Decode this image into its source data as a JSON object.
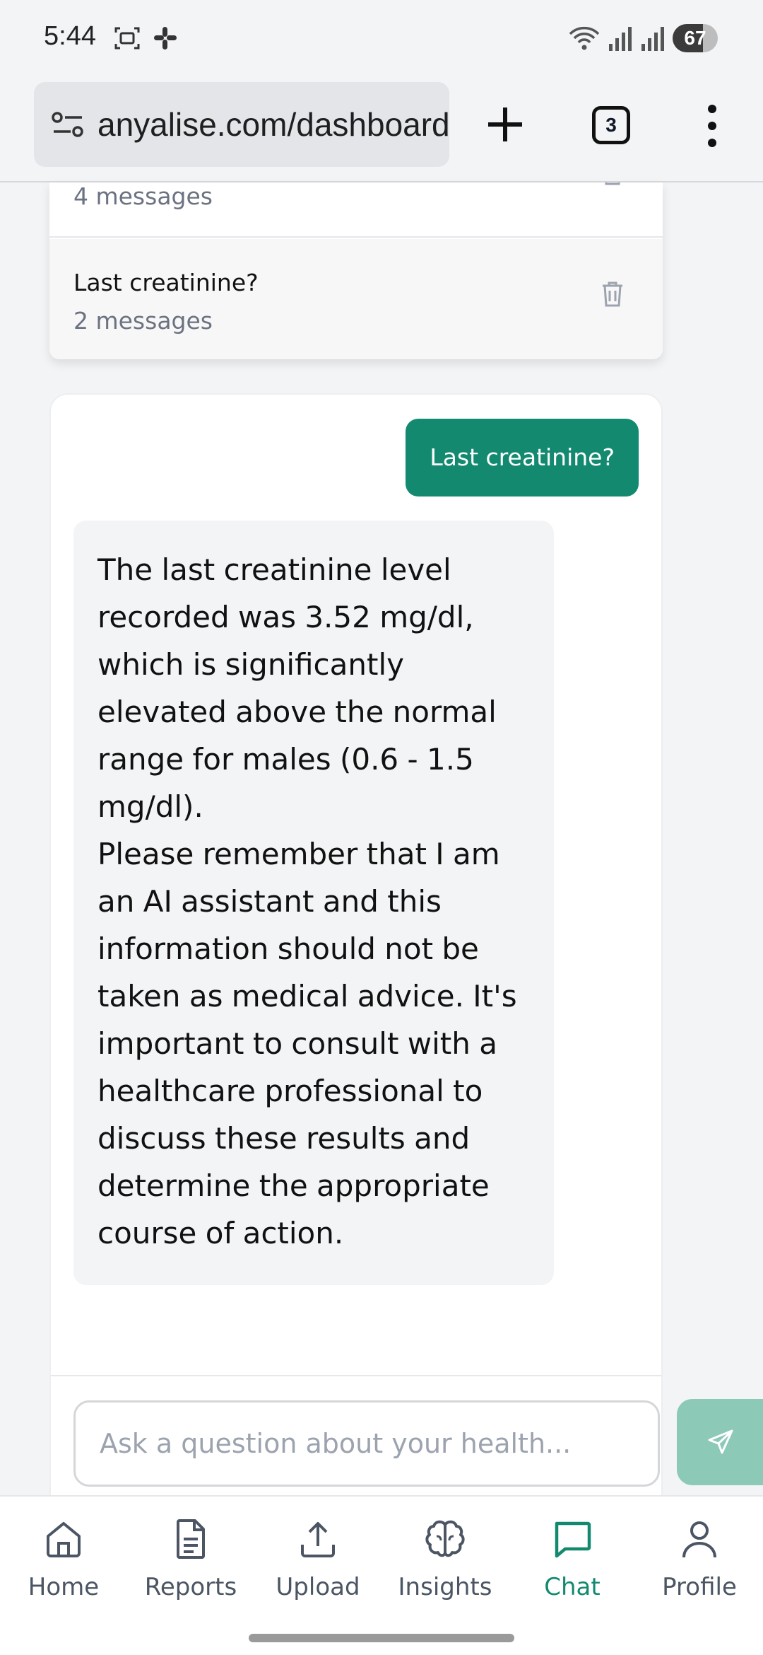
{
  "status_bar": {
    "time": "5:44",
    "battery": "67"
  },
  "browser": {
    "url": "anyalise.com/dashboard",
    "tab_count": "3"
  },
  "conversations": [
    {
      "title": "",
      "count": "4 messages"
    },
    {
      "title": "Last creatinine?",
      "count": "2 messages"
    }
  ],
  "chat": {
    "user_message": "Last creatinine?",
    "ai_message_paragraphs": [
      "The last creatinine level recorded was 3.52 mg/dl, which is significantly elevated above the normal range for males (0.6 - 1.5 mg/dl).",
      "Please remember that I am an AI assistant and this information should not be taken as medical advice. It's important to consult with a healthcare professional to discuss these results and determine the appropriate course of action."
    ],
    "input_placeholder": "Ask a question about your health..."
  },
  "nav": {
    "items": [
      {
        "label": "Home",
        "icon": "home-icon"
      },
      {
        "label": "Reports",
        "icon": "document-icon"
      },
      {
        "label": "Upload",
        "icon": "upload-icon"
      },
      {
        "label": "Insights",
        "icon": "brain-icon"
      },
      {
        "label": "Chat",
        "icon": "chat-icon"
      },
      {
        "label": "Profile",
        "icon": "user-icon"
      }
    ],
    "active_index": 4
  },
  "colors": {
    "accent": "#138a6f",
    "send_button": "#8cc9b6",
    "ai_bubble": "#f3f4f6"
  }
}
